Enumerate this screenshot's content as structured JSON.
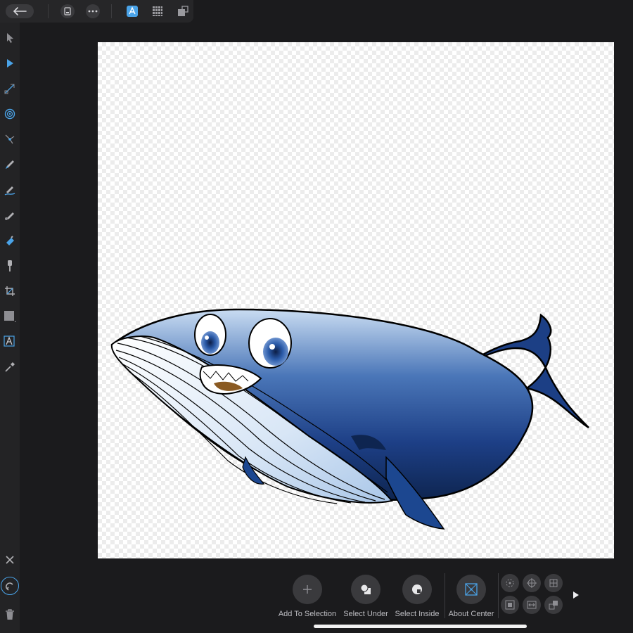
{
  "toolbar": {
    "back": "back-arrow-icon",
    "document": "document-icon",
    "more": "more-icon",
    "personas": [
      "designer-persona-icon",
      "pixel-persona-icon",
      "export-persona-icon"
    ]
  },
  "tools": [
    "move-tool-icon",
    "node-tool-icon",
    "corner-tool-icon",
    "point-transform-icon",
    "vector-crop-icon",
    "pen-tool-icon",
    "pencil-tool-icon",
    "vector-brush-icon",
    "fill-tool-icon",
    "transparency-tool-icon",
    "crop-tool-icon",
    "shape-tool-icon",
    "artistic-text-icon",
    "color-picker-icon"
  ],
  "bottom_tools": [
    "close-icon",
    "snapping-magnet-icon",
    "delete-icon"
  ],
  "context": {
    "add_to_selection": "Add To Selection",
    "select_under": "Select Under",
    "select_inside": "Select Inside",
    "about_center": "About Center"
  },
  "colors": {
    "accent": "#4aa3e8",
    "whale_dark": "#0e2550",
    "whale_light": "#c9dcf2"
  }
}
